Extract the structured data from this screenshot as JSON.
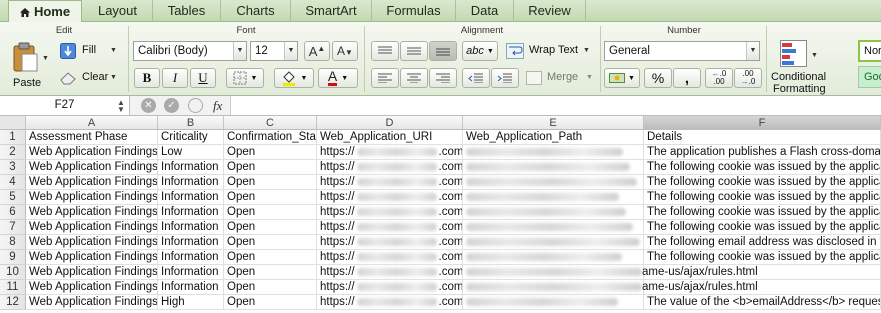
{
  "tabs": [
    "Home",
    "Layout",
    "Tables",
    "Charts",
    "SmartArt",
    "Formulas",
    "Data",
    "Review"
  ],
  "ribbon": {
    "groups": {
      "edit": "Edit",
      "font": "Font",
      "alignment": "Alignment",
      "number": "Number"
    },
    "paste_label": "Paste",
    "fill_label": "Fill",
    "clear_label": "Clear",
    "font_name": "Calibri (Body)",
    "font_size": "12",
    "bold": "B",
    "italic": "I",
    "underline": "U",
    "abc_label": "abc",
    "wrap_text_label": "Wrap Text",
    "merge_label": "Merge",
    "number_format": "General",
    "percent": "%",
    "comma": ",",
    "conditional_formatting_line1": "Conditional",
    "conditional_formatting_line2": "Formatting",
    "style_normal": "Nor",
    "style_good": "Goo"
  },
  "formula_bar": {
    "name_box": "F27",
    "fx": "fx",
    "content": ""
  },
  "columns": [
    "A",
    "B",
    "C",
    "D",
    "E",
    "F"
  ],
  "rows": [
    {
      "num": "1",
      "a": "Assessment Phase",
      "b": "Criticality",
      "c": "Confirmation_Stat",
      "d": "Web_Application_URI",
      "e": "Web_Application_Path",
      "f": "Details"
    },
    {
      "num": "2",
      "a": "Web Application Findings",
      "b": "Low",
      "c": "Open",
      "d_pre": "https://",
      "d_post": ".com",
      "e": "",
      "f": "The application publishes a Flash cross-domain p"
    },
    {
      "num": "3",
      "a": "Web Application Findings",
      "b": "Information",
      "c": "Open",
      "d_pre": "https://",
      "d_post": ".com",
      "e": "",
      "f": "The following cookie was issued by the applicati"
    },
    {
      "num": "4",
      "a": "Web Application Findings",
      "b": "Information",
      "c": "Open",
      "d_pre": "https://",
      "d_post": ".com",
      "e": "",
      "f": "The following cookie was issued by the applicati"
    },
    {
      "num": "5",
      "a": "Web Application Findings",
      "b": "Information",
      "c": "Open",
      "d_pre": "https://",
      "d_post": ".com",
      "e": "",
      "f": "The following cookie was issued by the applicati"
    },
    {
      "num": "6",
      "a": "Web Application Findings",
      "b": "Information",
      "c": "Open",
      "d_pre": "https://",
      "d_post": ".com",
      "e": "",
      "f": "The following cookie was issued by the applicati"
    },
    {
      "num": "7",
      "a": "Web Application Findings",
      "b": "Information",
      "c": "Open",
      "d_pre": "https://",
      "d_post": ".com",
      "e": "",
      "f": "The following cookie was issued by the applicati"
    },
    {
      "num": "8",
      "a": "Web Application Findings",
      "b": "Information",
      "c": "Open",
      "d_pre": "https://",
      "d_post": ".com",
      "e": "",
      "f": "The following email address was disclosed in the"
    },
    {
      "num": "9",
      "a": "Web Application Findings",
      "b": "Information",
      "c": "Open",
      "d_pre": "https://",
      "d_post": ".com",
      "e": "",
      "f": "The following cookie was issued by the applicati"
    },
    {
      "num": "10",
      "a": "Web Application Findings",
      "b": "Information",
      "c": "Open",
      "d_pre": "https://",
      "d_post": ".com",
      "e": "ame-us/ajax/rules.html",
      "f": ""
    },
    {
      "num": "11",
      "a": "Web Application Findings",
      "b": "Information",
      "c": "Open",
      "d_pre": "https://",
      "d_post": ".com",
      "e": "ame-us/ajax/rules.html",
      "f": ""
    },
    {
      "num": "12",
      "a": "Web Application Findings",
      "b": "High",
      "c": "Open",
      "d_pre": "https://",
      "d_post": ".com",
      "e": "",
      "f": "The value of the <b>emailAddress</b> request p"
    }
  ],
  "colors": {
    "tab_bar": "#c3d9b2",
    "font_color_red": "#d01010",
    "highlight_yellow": "#f5e800"
  }
}
